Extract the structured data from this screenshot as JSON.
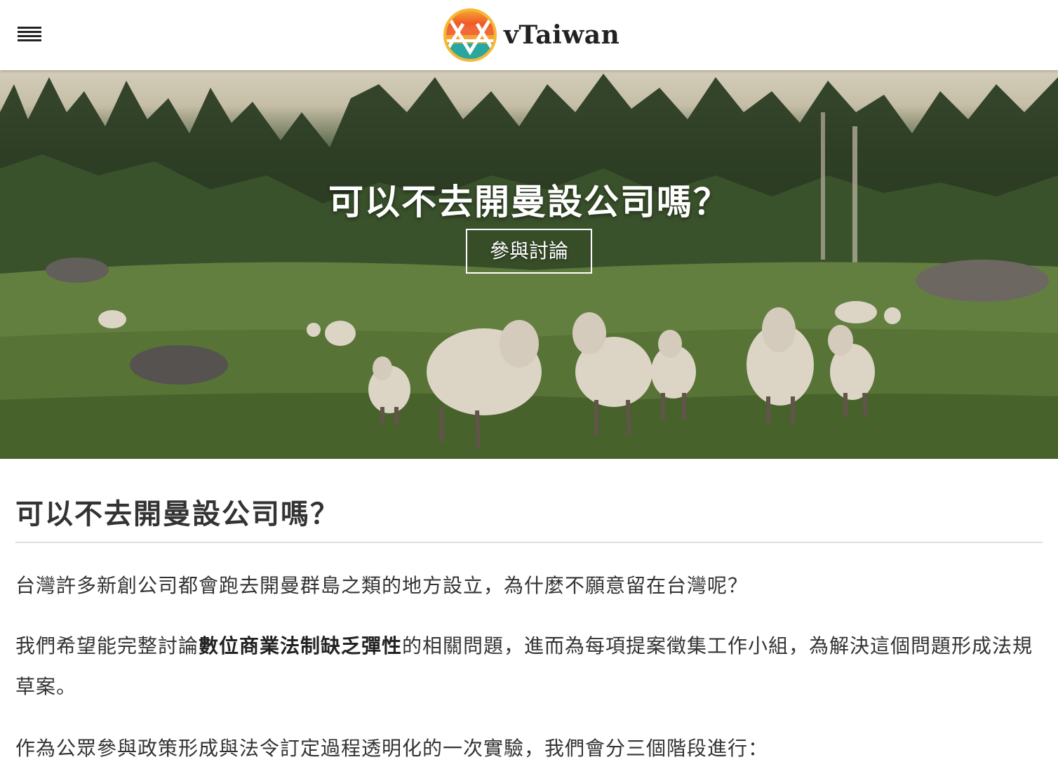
{
  "header": {
    "menu_icon": "hamburger-menu-icon",
    "logo_icon": "vtaiwan-logo-icon",
    "brand_name": "vTaiwan"
  },
  "hero": {
    "image": "sheep-in-meadow-photo",
    "title": "可以不去開曼設公司嗎？",
    "cta_label": "參與討論"
  },
  "article": {
    "title": "可以不去開曼設公司嗎？",
    "paragraph1": "台灣許多新創公司都會跑去開曼群島之類的地方設立，為什麼不願意留在台灣呢？",
    "paragraph2_before": "我們希望能完整討論",
    "paragraph2_bold": "數位商業法制缺乏彈性",
    "paragraph2_after": "的相關問題，進而為每項提案徵集工作小組，為解決這個問題形成法規草案。",
    "paragraph3": "作為公眾參與政策形成與法令訂定過程透明化的一次實驗，我們會分三個階段進行："
  },
  "colors": {
    "logo_orange": "#f05a28",
    "logo_yellow": "#f7b733",
    "logo_teal": "#2aa6a0",
    "text": "#333333"
  }
}
